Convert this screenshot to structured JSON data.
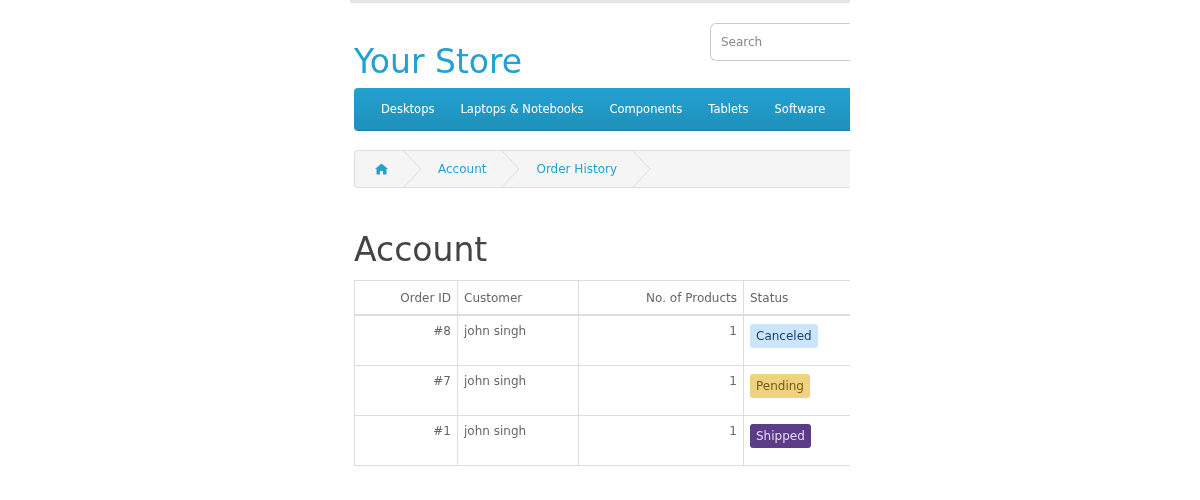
{
  "header": {
    "store_name": "Your Store",
    "search": {
      "placeholder": "Search"
    }
  },
  "menu": [
    {
      "label": "Desktops"
    },
    {
      "label": "Laptops & Notebooks"
    },
    {
      "label": "Components"
    },
    {
      "label": "Tablets"
    },
    {
      "label": "Software"
    }
  ],
  "breadcrumb": [
    {
      "kind": "home"
    },
    {
      "kind": "link",
      "label": "Account"
    },
    {
      "kind": "link",
      "label": "Order History"
    }
  ],
  "page_title": "Account",
  "table": {
    "columns": [
      "Order ID",
      "Customer",
      "No. of Products",
      "Status"
    ],
    "rows": [
      {
        "order_id": "#8",
        "customer": "john singh",
        "products": "1",
        "status": {
          "label": "Canceled",
          "color": "#cce5ff"
        }
      },
      {
        "order_id": "#7",
        "customer": "john singh",
        "products": "1",
        "status": {
          "label": "Pending",
          "color": "#eed27f"
        }
      },
      {
        "order_id": "#1",
        "customer": "john singh",
        "products": "1",
        "status": {
          "label": "Shipped",
          "color": "#5c3c86"
        }
      }
    ]
  }
}
